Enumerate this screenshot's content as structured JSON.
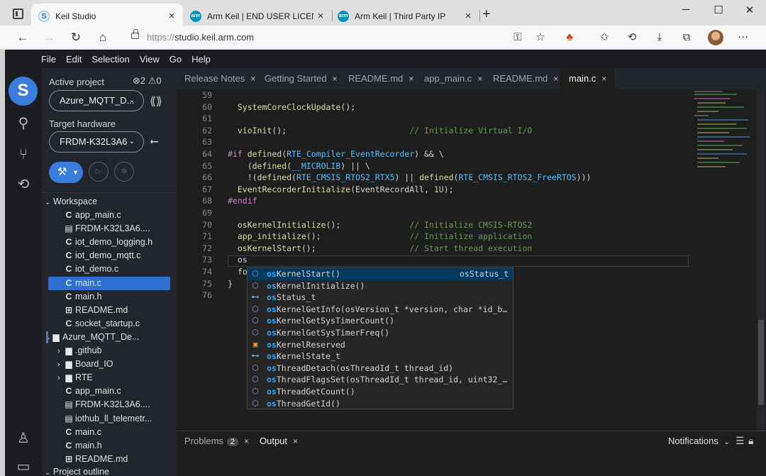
{
  "browser": {
    "tabs": [
      {
        "label": "Keil Studio",
        "favicon": "keil-studio-icon",
        "active": true
      },
      {
        "label": "Arm Keil | END USER LICENSE AGREEMENT",
        "favicon": "arm-icon",
        "active": false
      },
      {
        "label": "Arm Keil | Third Party IP",
        "favicon": "arm-icon",
        "active": false
      }
    ],
    "tab_close_glyph": "×",
    "new_tab_glyph": "+",
    "favicon_arm_text": "arm",
    "favicon_keil_text": "S",
    "url_protocol": "https://",
    "url_host": "studio.keil.arm.com"
  },
  "ide": {
    "menu": [
      "File",
      "Edit",
      "Selection",
      "View",
      "Go",
      "Help"
    ],
    "logo_glyph": "S",
    "sidebar": {
      "active_project_label": "Active project",
      "error_count": "2",
      "warning_count": "0",
      "project_name": "Azure_MQTT_D...",
      "target_hardware_label": "Target hardware",
      "target_name": "FRDM-K32L3A6",
      "workspace_label": "Workspace",
      "project_outline_label": "Project outline",
      "tree": [
        {
          "label": "app_main.c",
          "icon": "c-file-icon",
          "glyph": "C",
          "indent": 32
        },
        {
          "label": "FRDM-K32L3A6....",
          "icon": "file-icon",
          "glyph": "▤",
          "indent": 32
        },
        {
          "label": "iot_demo_logging.h",
          "icon": "c-file-icon",
          "glyph": "C",
          "indent": 32
        },
        {
          "label": "iot_demo_mqtt.c",
          "icon": "c-file-icon",
          "glyph": "C",
          "indent": 32
        },
        {
          "label": "iot_demo.c",
          "icon": "c-file-icon",
          "glyph": "C",
          "indent": 32
        },
        {
          "label": "main.c",
          "icon": "c-file-icon",
          "glyph": "C",
          "indent": 32,
          "selected": true
        },
        {
          "label": "main.h",
          "icon": "c-file-icon",
          "glyph": "C",
          "indent": 32
        },
        {
          "label": "README.md",
          "icon": "markdown-icon",
          "glyph": "⊞",
          "indent": 32
        },
        {
          "label": "socket_startup.c",
          "icon": "c-file-icon",
          "glyph": "C",
          "indent": 32
        },
        {
          "label": "Azure_MQTT_De...",
          "icon": "folder-icon",
          "glyph": "▆",
          "indent": 14,
          "chevron": "⌄"
        },
        {
          "label": ".github",
          "icon": "folder-icon",
          "glyph": "▆",
          "indent": 32,
          "chevron": "›"
        },
        {
          "label": "Board_IO",
          "icon": "folder-icon",
          "glyph": "▆",
          "indent": 32,
          "chevron": "›"
        },
        {
          "label": "RTE",
          "icon": "folder-icon",
          "glyph": "▆",
          "indent": 32,
          "chevron": "›"
        },
        {
          "label": "app_main.c",
          "icon": "c-file-icon",
          "glyph": "C",
          "indent": 32
        },
        {
          "label": "FRDM-K32L3A6....",
          "icon": "file-icon",
          "glyph": "▤",
          "indent": 32
        },
        {
          "label": "iothub_ll_telemetr...",
          "icon": "file-icon",
          "glyph": "▤",
          "indent": 32
        },
        {
          "label": "main.c",
          "icon": "c-file-icon",
          "glyph": "C",
          "indent": 32
        },
        {
          "label": "main.h",
          "icon": "c-file-icon",
          "glyph": "C",
          "indent": 32
        },
        {
          "label": "README.md",
          "icon": "markdown-icon",
          "glyph": "⊞",
          "indent": 32
        }
      ]
    },
    "editor_tabs": [
      {
        "label": "Release Notes",
        "active": false
      },
      {
        "label": "Getting Started",
        "active": false
      },
      {
        "label": "README.md",
        "active": false
      },
      {
        "label": "app_main.c",
        "active": false
      },
      {
        "label": "README.md",
        "active": false
      },
      {
        "label": "main.c",
        "active": true
      }
    ],
    "editor_tab_close": "×",
    "code_lines": [
      {
        "n": "59",
        "html": ""
      },
      {
        "n": "60",
        "html": "  <span class='fn'>SystemCoreClockUpdate</span>();"
      },
      {
        "n": "61",
        "html": ""
      },
      {
        "n": "62",
        "html": "  <span class='fn'>vioInit</span>();                         <span class='cm'>// Initialize Virtual I/O</span>"
      },
      {
        "n": "63",
        "html": ""
      },
      {
        "n": "64",
        "html": "<span class='pp'>#if</span> <span class='fn'>defined</span>(<span class='mac'>RTE_Compiler_EventRecorder</span>) &amp;&amp; \\"
      },
      {
        "n": "65",
        "html": "    (<span class='fn'>defined</span>(<span class='mac'>__MICROLIB</span>) || \\"
      },
      {
        "n": "66",
        "html": "    !(<span class='fn'>defined</span>(<span class='mac'>RTE_CMSIS_RTOS2_RTX5</span>) || <span class='fn'>defined</span>(<span class='mac'>RTE_CMSIS_RTOS2_FreeRTOS</span>)))"
      },
      {
        "n": "67",
        "html": "  <span class='fn'>EventRecorderInitialize</span>(EventRecordAll, <span class='nm'>1U</span>);"
      },
      {
        "n": "68",
        "html": "<span class='pp'>#endif</span>"
      },
      {
        "n": "69",
        "html": ""
      },
      {
        "n": "70",
        "html": "  <span class='fn'>osKernelInitialize</span>();              <span class='cm'>// Initialize CMSIS-RTOS2</span>"
      },
      {
        "n": "71",
        "html": "  <span class='fn'>app_initialize</span>();                  <span class='cm'>// Initialize application</span>"
      },
      {
        "n": "72",
        "html": "  <span class='fn'>osKernelStart</span>();                   <span class='cm'>// Start thread execution</span>"
      },
      {
        "n": "73",
        "html": "  os"
      },
      {
        "n": "74",
        "html": "  fo"
      },
      {
        "n": "75",
        "html": "}"
      },
      {
        "n": "76",
        "html": ""
      }
    ],
    "suggestions": [
      {
        "icon": "cube-icon",
        "glyph": "⬡",
        "cls": "cube",
        "prefix": "os",
        "rest": "KernelStart()",
        "detail": "osStatus_t",
        "selected": true
      },
      {
        "icon": "cube-icon",
        "glyph": "⬡",
        "cls": "cube",
        "prefix": "os",
        "rest": "KernelInitialize()",
        "detail": ""
      },
      {
        "icon": "type-icon",
        "glyph": "⊷",
        "cls": "type",
        "prefix": "os",
        "rest": "Status_t",
        "detail": ""
      },
      {
        "icon": "cube-icon",
        "glyph": "⬡",
        "cls": "cube",
        "prefix": "os",
        "rest": "KernelGetInfo(osVersion_t *version, char *id_b…",
        "detail": ""
      },
      {
        "icon": "cube-icon",
        "glyph": "⬡",
        "cls": "cube",
        "prefix": "os",
        "rest": "KernelGetSysTimerCount()",
        "detail": ""
      },
      {
        "icon": "cube-icon",
        "glyph": "⬡",
        "cls": "cube",
        "prefix": "os",
        "rest": "KernelGetSysTimerFreq()",
        "detail": ""
      },
      {
        "icon": "enum-icon",
        "glyph": "▣",
        "cls": "enum",
        "prefix": "os",
        "rest": "KernelReserved",
        "detail": ""
      },
      {
        "icon": "type-icon",
        "glyph": "⊷",
        "cls": "type",
        "prefix": "os",
        "rest": "KernelState_t",
        "detail": ""
      },
      {
        "icon": "cube-icon",
        "glyph": "⬡",
        "cls": "cube",
        "prefix": "os",
        "rest": "ThreadDetach(osThreadId_t thread_id)",
        "detail": ""
      },
      {
        "icon": "cube-icon",
        "glyph": "⬡",
        "cls": "cube",
        "prefix": "os",
        "rest": "ThreadFlagsSet(osThreadId_t thread_id, uint32_…",
        "detail": ""
      },
      {
        "icon": "cube-icon",
        "glyph": "⬡",
        "cls": "cube",
        "prefix": "os",
        "rest": "ThreadGetCount()",
        "detail": ""
      },
      {
        "icon": "cube-icon",
        "glyph": "⬡",
        "cls": "cube",
        "prefix": "os",
        "rest": "ThreadGetId()",
        "detail": ""
      }
    ],
    "panel": {
      "problems_label": "Problems",
      "problems_count": "2",
      "output_label": "Output",
      "notifications_label": "Notifications"
    }
  },
  "colors": {
    "accent": "#3b7ddd",
    "selection": "#2f6fd0",
    "editor_bg": "#1e1e1e"
  }
}
